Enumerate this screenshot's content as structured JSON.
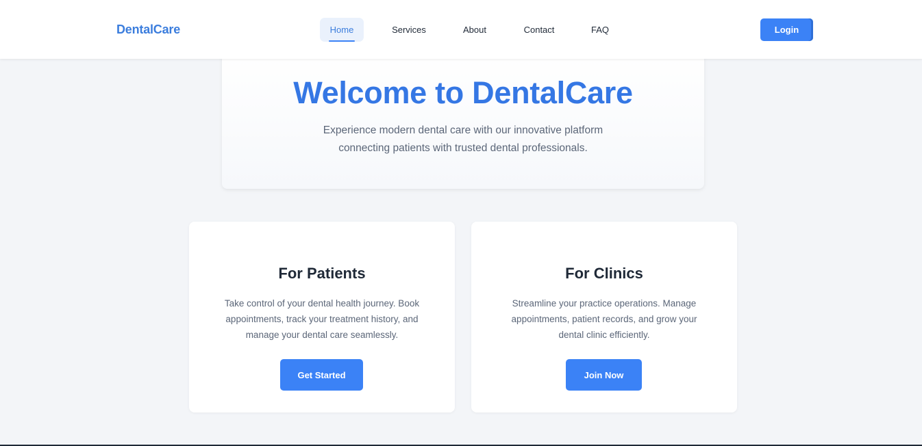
{
  "navbar": {
    "brand": "DentalCare",
    "links": [
      {
        "label": "Home",
        "active": true
      },
      {
        "label": "Services",
        "active": false
      },
      {
        "label": "About",
        "active": false
      },
      {
        "label": "Contact",
        "active": false
      },
      {
        "label": "FAQ",
        "active": false
      }
    ],
    "login_label": "Login"
  },
  "hero": {
    "title": "Welcome to DentalCare",
    "subtitle": "Experience modern dental care with our innovative platform connecting patients with trusted dental professionals."
  },
  "cards": [
    {
      "title": "For Patients",
      "description": "Take control of your dental health journey. Book appointments, track your treatment history, and manage your dental care seamlessly.",
      "button_label": "Get Started"
    },
    {
      "title": "For Clinics",
      "description": "Streamline your practice operations. Manage appointments, patient records, and grow your dental clinic efficiently.",
      "button_label": "Join Now"
    }
  ],
  "colors": {
    "brand": "#3b7ddd",
    "primary_button": "#3b82f6",
    "page_background": "#f3f5f8"
  }
}
